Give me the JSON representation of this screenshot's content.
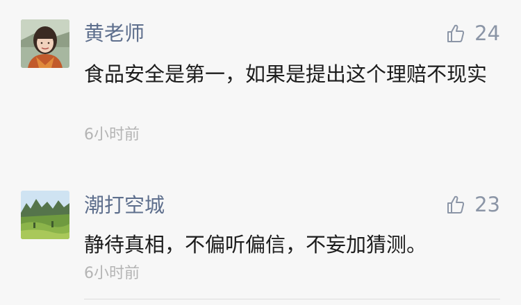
{
  "comments": [
    {
      "username": "黄老师",
      "likes": "24",
      "content": "食品安全是第一，如果是提出这个理赔不现实",
      "timestamp": "6小时前",
      "avatar_icon": "avatar-woman-portrait",
      "like_icon": "thumbs-up-icon"
    },
    {
      "username": "潮打空城",
      "likes": "23",
      "content": "静待真相，不偏听偏信，不妄加猜测。",
      "timestamp": "6小时前",
      "avatar_icon": "avatar-landscape",
      "like_icon": "thumbs-up-icon"
    }
  ],
  "colors": {
    "background": "#f7f7f7",
    "username": "#5e6f8d",
    "content": "#1c1c1c",
    "timestamp": "#b4b4b4",
    "like": "#8b95a6"
  }
}
